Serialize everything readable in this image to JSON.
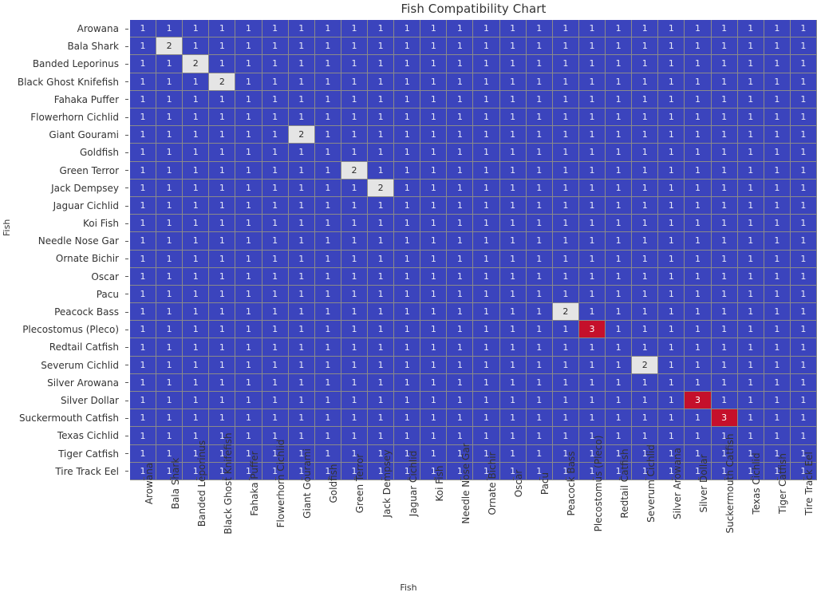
{
  "chart_data": {
    "type": "heatmap",
    "title": "Fish Compatibility Chart",
    "xlabel": "Fish",
    "ylabel": "Fish",
    "grid": true,
    "legend": "none",
    "annotate": true,
    "value_colors": {
      "1": "#3b44bd",
      "2": "#e5e5e5",
      "3": "#c5102b"
    },
    "value_text_colors": {
      "1": "#e9eaf7",
      "2": "#2b2b2b",
      "3": "#ffffff"
    },
    "zlim": [
      1,
      3
    ],
    "categories": [
      "Arowana",
      "Bala Shark",
      "Banded Leporinus",
      "Black Ghost Knifefish",
      "Fahaka Puffer",
      "Flowerhorn Cichlid",
      "Giant Gourami",
      "Goldfish",
      "Green Terror",
      "Jack Dempsey",
      "Jaguar Cichlid",
      "Koi Fish",
      "Needle Nose Gar",
      "Ornate Bichir",
      "Oscar",
      "Pacu",
      "Peacock Bass",
      "Plecostomus (Pleco)",
      "Redtail Catfish",
      "Severum Cichlid",
      "Silver Arowana",
      "Silver Dollar",
      "Suckermouth Catfish",
      "Texas Cichlid",
      "Tiger Catfish",
      "Tire Track Eel"
    ],
    "x": [
      "Arowana",
      "Bala Shark",
      "Banded Leporinus",
      "Black Ghost Knifefish",
      "Fahaka Puffer",
      "Flowerhorn Cichlid",
      "Giant Gourami",
      "Goldfish",
      "Green Terror",
      "Jack Dempsey",
      "Jaguar Cichlid",
      "Koi Fish",
      "Needle Nose Gar",
      "Ornate Bichir",
      "Oscar",
      "Pacu",
      "Peacock Bass",
      "Plecostomus (Pleco)",
      "Redtail Catfish",
      "Severum Cichlid",
      "Silver Arowana",
      "Silver Dollar",
      "Suckermouth Catfish",
      "Texas Cichlid",
      "Tiger Catfish",
      "Tire Track Eel"
    ],
    "values": [
      [
        1,
        1,
        1,
        1,
        1,
        1,
        1,
        1,
        1,
        1,
        1,
        1,
        1,
        1,
        1,
        1,
        1,
        1,
        1,
        1,
        1,
        1,
        1,
        1,
        1,
        1
      ],
      [
        1,
        2,
        1,
        1,
        1,
        1,
        1,
        1,
        1,
        1,
        1,
        1,
        1,
        1,
        1,
        1,
        1,
        1,
        1,
        1,
        1,
        1,
        1,
        1,
        1,
        1
      ],
      [
        1,
        1,
        2,
        1,
        1,
        1,
        1,
        1,
        1,
        1,
        1,
        1,
        1,
        1,
        1,
        1,
        1,
        1,
        1,
        1,
        1,
        1,
        1,
        1,
        1,
        1
      ],
      [
        1,
        1,
        1,
        2,
        1,
        1,
        1,
        1,
        1,
        1,
        1,
        1,
        1,
        1,
        1,
        1,
        1,
        1,
        1,
        1,
        1,
        1,
        1,
        1,
        1,
        1
      ],
      [
        1,
        1,
        1,
        1,
        1,
        1,
        1,
        1,
        1,
        1,
        1,
        1,
        1,
        1,
        1,
        1,
        1,
        1,
        1,
        1,
        1,
        1,
        1,
        1,
        1,
        1
      ],
      [
        1,
        1,
        1,
        1,
        1,
        1,
        1,
        1,
        1,
        1,
        1,
        1,
        1,
        1,
        1,
        1,
        1,
        1,
        1,
        1,
        1,
        1,
        1,
        1,
        1,
        1
      ],
      [
        1,
        1,
        1,
        1,
        1,
        1,
        2,
        1,
        1,
        1,
        1,
        1,
        1,
        1,
        1,
        1,
        1,
        1,
        1,
        1,
        1,
        1,
        1,
        1,
        1,
        1
      ],
      [
        1,
        1,
        1,
        1,
        1,
        1,
        1,
        1,
        1,
        1,
        1,
        1,
        1,
        1,
        1,
        1,
        1,
        1,
        1,
        1,
        1,
        1,
        1,
        1,
        1,
        1
      ],
      [
        1,
        1,
        1,
        1,
        1,
        1,
        1,
        1,
        2,
        1,
        1,
        1,
        1,
        1,
        1,
        1,
        1,
        1,
        1,
        1,
        1,
        1,
        1,
        1,
        1,
        1
      ],
      [
        1,
        1,
        1,
        1,
        1,
        1,
        1,
        1,
        1,
        2,
        1,
        1,
        1,
        1,
        1,
        1,
        1,
        1,
        1,
        1,
        1,
        1,
        1,
        1,
        1,
        1
      ],
      [
        1,
        1,
        1,
        1,
        1,
        1,
        1,
        1,
        1,
        1,
        1,
        1,
        1,
        1,
        1,
        1,
        1,
        1,
        1,
        1,
        1,
        1,
        1,
        1,
        1,
        1
      ],
      [
        1,
        1,
        1,
        1,
        1,
        1,
        1,
        1,
        1,
        1,
        1,
        1,
        1,
        1,
        1,
        1,
        1,
        1,
        1,
        1,
        1,
        1,
        1,
        1,
        1,
        1
      ],
      [
        1,
        1,
        1,
        1,
        1,
        1,
        1,
        1,
        1,
        1,
        1,
        1,
        1,
        1,
        1,
        1,
        1,
        1,
        1,
        1,
        1,
        1,
        1,
        1,
        1,
        1
      ],
      [
        1,
        1,
        1,
        1,
        1,
        1,
        1,
        1,
        1,
        1,
        1,
        1,
        1,
        1,
        1,
        1,
        1,
        1,
        1,
        1,
        1,
        1,
        1,
        1,
        1,
        1
      ],
      [
        1,
        1,
        1,
        1,
        1,
        1,
        1,
        1,
        1,
        1,
        1,
        1,
        1,
        1,
        1,
        1,
        1,
        1,
        1,
        1,
        1,
        1,
        1,
        1,
        1,
        1
      ],
      [
        1,
        1,
        1,
        1,
        1,
        1,
        1,
        1,
        1,
        1,
        1,
        1,
        1,
        1,
        1,
        1,
        1,
        1,
        1,
        1,
        1,
        1,
        1,
        1,
        1,
        1
      ],
      [
        1,
        1,
        1,
        1,
        1,
        1,
        1,
        1,
        1,
        1,
        1,
        1,
        1,
        1,
        1,
        1,
        2,
        1,
        1,
        1,
        1,
        1,
        1,
        1,
        1,
        1
      ],
      [
        1,
        1,
        1,
        1,
        1,
        1,
        1,
        1,
        1,
        1,
        1,
        1,
        1,
        1,
        1,
        1,
        1,
        3,
        1,
        1,
        1,
        1,
        1,
        1,
        1,
        1
      ],
      [
        1,
        1,
        1,
        1,
        1,
        1,
        1,
        1,
        1,
        1,
        1,
        1,
        1,
        1,
        1,
        1,
        1,
        1,
        1,
        1,
        1,
        1,
        1,
        1,
        1,
        1
      ],
      [
        1,
        1,
        1,
        1,
        1,
        1,
        1,
        1,
        1,
        1,
        1,
        1,
        1,
        1,
        1,
        1,
        1,
        1,
        1,
        2,
        1,
        1,
        1,
        1,
        1,
        1
      ],
      [
        1,
        1,
        1,
        1,
        1,
        1,
        1,
        1,
        1,
        1,
        1,
        1,
        1,
        1,
        1,
        1,
        1,
        1,
        1,
        1,
        1,
        1,
        1,
        1,
        1,
        1
      ],
      [
        1,
        1,
        1,
        1,
        1,
        1,
        1,
        1,
        1,
        1,
        1,
        1,
        1,
        1,
        1,
        1,
        1,
        1,
        1,
        1,
        1,
        3,
        1,
        1,
        1,
        1
      ],
      [
        1,
        1,
        1,
        1,
        1,
        1,
        1,
        1,
        1,
        1,
        1,
        1,
        1,
        1,
        1,
        1,
        1,
        1,
        1,
        1,
        1,
        1,
        3,
        1,
        1,
        1
      ],
      [
        1,
        1,
        1,
        1,
        1,
        1,
        1,
        1,
        1,
        1,
        1,
        1,
        1,
        1,
        1,
        1,
        1,
        1,
        1,
        1,
        1,
        1,
        1,
        1,
        1,
        1
      ],
      [
        1,
        1,
        1,
        1,
        1,
        1,
        1,
        1,
        1,
        1,
        1,
        1,
        1,
        1,
        1,
        1,
        1,
        1,
        1,
        1,
        1,
        1,
        1,
        1,
        1,
        1
      ],
      [
        1,
        1,
        1,
        1,
        1,
        1,
        1,
        1,
        1,
        1,
        1,
        1,
        1,
        1,
        1,
        1,
        1,
        1,
        1,
        1,
        1,
        1,
        1,
        1,
        1,
        1
      ]
    ]
  }
}
